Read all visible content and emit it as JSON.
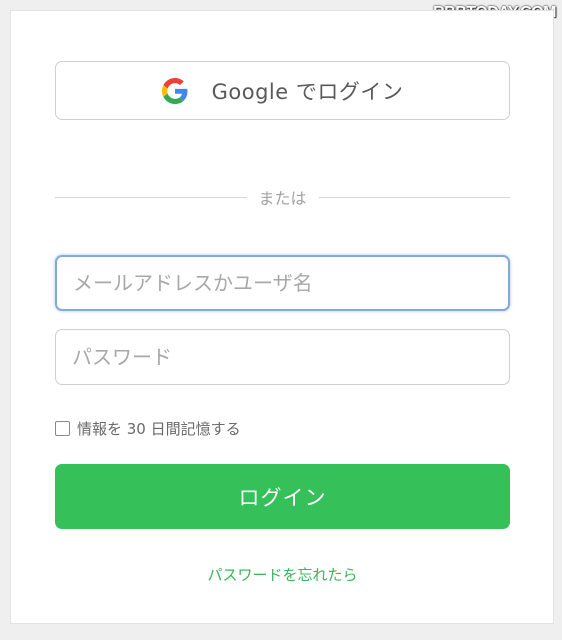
{
  "watermark": "RBBTODAY.COM",
  "google_button": {
    "label": "Google でログイン",
    "icon": "google-g-logo-icon",
    "colors": {
      "blue": "#4285F4",
      "red": "#EA4335",
      "yellow": "#FBBC05",
      "green": "#34A853"
    }
  },
  "divider": {
    "text": "または"
  },
  "email_field": {
    "placeholder": "メールアドレスかユーザ名",
    "value": ""
  },
  "password_field": {
    "placeholder": "パスワード",
    "value": ""
  },
  "remember": {
    "label": "情報を 30 日間記憶する",
    "checked": false
  },
  "login_button": {
    "label": "ログイン",
    "color": "#35c05a"
  },
  "forgot_link": {
    "label": "パスワードを忘れたら",
    "color": "#39b55a"
  }
}
